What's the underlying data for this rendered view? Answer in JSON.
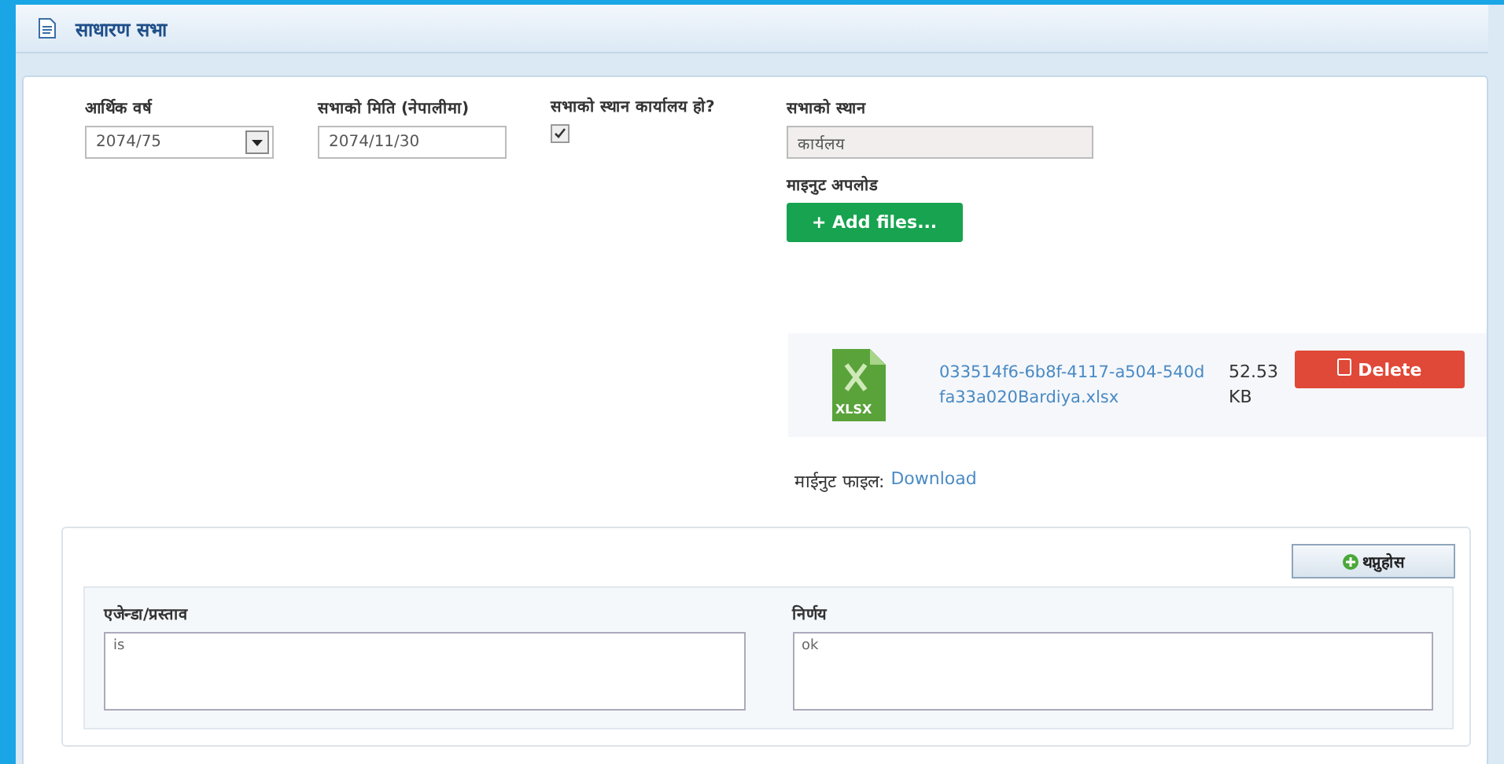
{
  "header": {
    "title": "साधारण सभा"
  },
  "fields": [
    {
      "kind": "select",
      "label": "आर्थिक वर्ष",
      "value": "2074/75"
    },
    {
      "kind": "text",
      "label": "सभाको मिति (नेपालीमा)",
      "value": "2074/11/30"
    },
    {
      "kind": "checkbox",
      "label": "सभाको स्थान कार्यालय हो?",
      "checked": true
    }
  ],
  "venue": {
    "label": "सभाको स्थान",
    "value": "कार्यलय",
    "disabled": true
  },
  "upload": {
    "label": "माइनुट अपलोड",
    "button": "+ Add files...",
    "file": {
      "name": "033514f6-6b8f-4117-a504-540dfa33a020Bardiya.xlsx",
      "size": "52.53 KB",
      "type_label": "XLSX",
      "delete": "Delete"
    },
    "download_label": "माईनुट फाइल:",
    "download_link": "Download"
  },
  "agenda": {
    "add_button": "थप्नुहोस",
    "fields": [
      {
        "label": "एजेन्डा/प्रस्ताव",
        "value": "is"
      },
      {
        "label": "निर्णय",
        "value": "ok"
      }
    ]
  }
}
